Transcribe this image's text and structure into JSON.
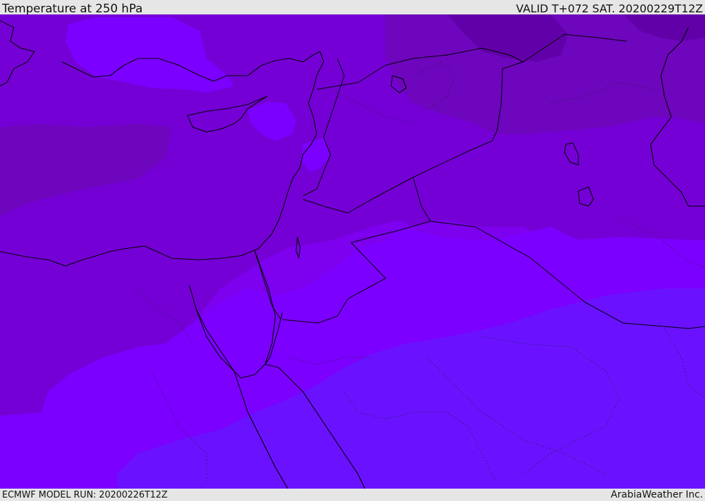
{
  "header": {
    "title": "Temperature at 250 hPa",
    "valid": "VALID T+072 SAT. 20200229T12Z"
  },
  "footer": {
    "model_run": "ECMWF MODEL RUN: 20200226T12Z",
    "credit": "ArabiaWeather Inc."
  },
  "map": {
    "region": "Eastern Mediterranean and Middle East",
    "colors": {
      "warmest_blue": "#6a12ff",
      "blue_violet": "#7c00ff",
      "violet": "#7d00ee",
      "mid_purple": "#7500d6",
      "dark_purple": "#6e06bd",
      "deepest_purple": "#6100a8",
      "coastline": "#000000",
      "border_dotted": "#2a1a5a"
    }
  }
}
